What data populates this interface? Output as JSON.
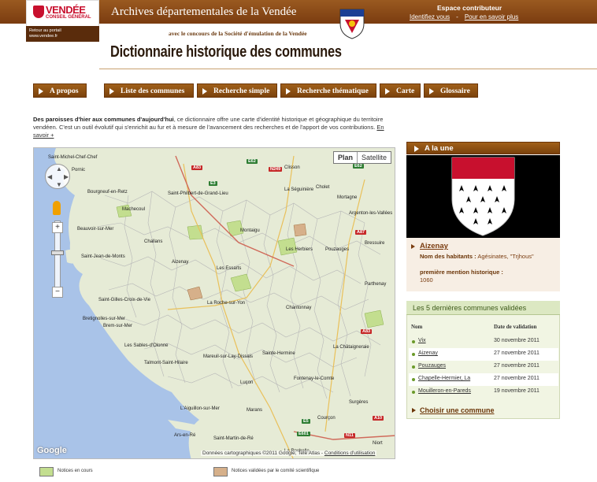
{
  "header": {
    "logo_brand": "VENDÉE",
    "logo_sub": "CONSEIL GÉNÉRAL",
    "portal_line1": "Retour au portail",
    "portal_line2": "www.vendee.fr",
    "site_title": "Archives départementales de la Vendée",
    "contrib_title": "Espace contributeur",
    "contrib_login": "Identifiez vous",
    "contrib_sep": "-",
    "contrib_more": "Pour en savoir plus",
    "concours": "avec le concours de la Société d'émulation de la Vendée",
    "dict_title": "Dictionnaire historique des communes"
  },
  "nav": {
    "items": [
      {
        "label": "A propos"
      },
      {
        "label": "Liste des communes"
      },
      {
        "label": "Recherche simple"
      },
      {
        "label": "Recherche thématique"
      },
      {
        "label": "Carte"
      },
      {
        "label": "Glossaire"
      }
    ]
  },
  "intro": {
    "bold": "Des paroisses d'hier aux communes d'aujourd'hui",
    "text": ", ce dictionnaire offre une carte d'identité historique et géographique du territoire vendéen. C'est un outil évolutif qui s'enrichit au fur et à mesure de l'avancement des recherches et de l'apport de vos contributions. ",
    "more_link": "En savoir +"
  },
  "map": {
    "toggle_plan": "Plan",
    "toggle_satellite": "Satellite",
    "google_logo": "Google",
    "attribution": "Données cartographiques ©2011 Google, Tele Atlas - ",
    "terms_link": "Conditions d'utilisation",
    "places": [
      "Saint-Michel-Chef-Chef",
      "Pornic",
      "Bourgneuf-en-Retz",
      "Machecoul",
      "Challans",
      "Saint-Philbert-de-Grand-Lieu",
      "Clisson",
      "Cholet",
      "La Séguinière",
      "Mortagne",
      "Les Herbiers",
      "Aizenay",
      "Saint-Gilles-Croix-de-Vie",
      "Bretignolles-sur-Mer",
      "Brem-sur-Mer",
      "Les Sables-d'Olonne",
      "La Roche-sur-Yon",
      "Luçon",
      "L'Aiguillon-sur-Mer",
      "La Rochelle",
      "Pouzauges",
      "Chantonnay",
      "Argenton-les-Vallées",
      "Bressuire",
      "Ars-en-Ré",
      "Saint-Martin-de-Ré",
      "Fontenay-le-Comte",
      "Niort",
      "Marans",
      "Montaigu",
      "Saint-Jean-de-Monts",
      "Beauvoir-sur-Mer",
      "Les Essarts",
      "Talmont-Saint-Hilaire",
      "Mareuil-sur-Lay-Dissais",
      "Sainte-Hermine",
      "La Châtaigneraie",
      "Parthenay",
      "Courçon",
      "Surgères"
    ],
    "highways": [
      "A83",
      "E62",
      "N249",
      "E3",
      "A87",
      "E62",
      "A83",
      "E601",
      "N11",
      "A10",
      "E5"
    ]
  },
  "legend": {
    "current_label": "Notices en cours",
    "validated_label": "Notices validées par le comité scientifique",
    "current_color": "#c3de8f",
    "validated_color": "#d6b08a"
  },
  "a_la_une": {
    "header": "A la une",
    "commune_link": "Aizenay",
    "habitants_label": "Nom des habitants :",
    "habitants_value": "Agésinates, \"Trjhous\"",
    "mention_label": "première mention historique :",
    "mention_value": "1060"
  },
  "validated": {
    "header": "Les 5 dernières communes validées",
    "col_name": "Nom",
    "col_date": "Date de validation",
    "rows": [
      {
        "name": "Vix",
        "date": "30 novembre 2011"
      },
      {
        "name": "Aizenay",
        "date": "27 novembre 2011"
      },
      {
        "name": "Pouzauges",
        "date": "27 novembre 2011"
      },
      {
        "name": "Chapelle-Hermier, La",
        "date": "27 novembre 2011"
      },
      {
        "name": "Mouilleron-en-Pareds",
        "date": "19 novembre 2011"
      }
    ],
    "choose_link": "Choisir une commune"
  },
  "colors": {
    "brown": "#7b420c",
    "accent_red": "#c8102e",
    "sea": "#a9c3e8",
    "land": "#e6ebd6"
  }
}
